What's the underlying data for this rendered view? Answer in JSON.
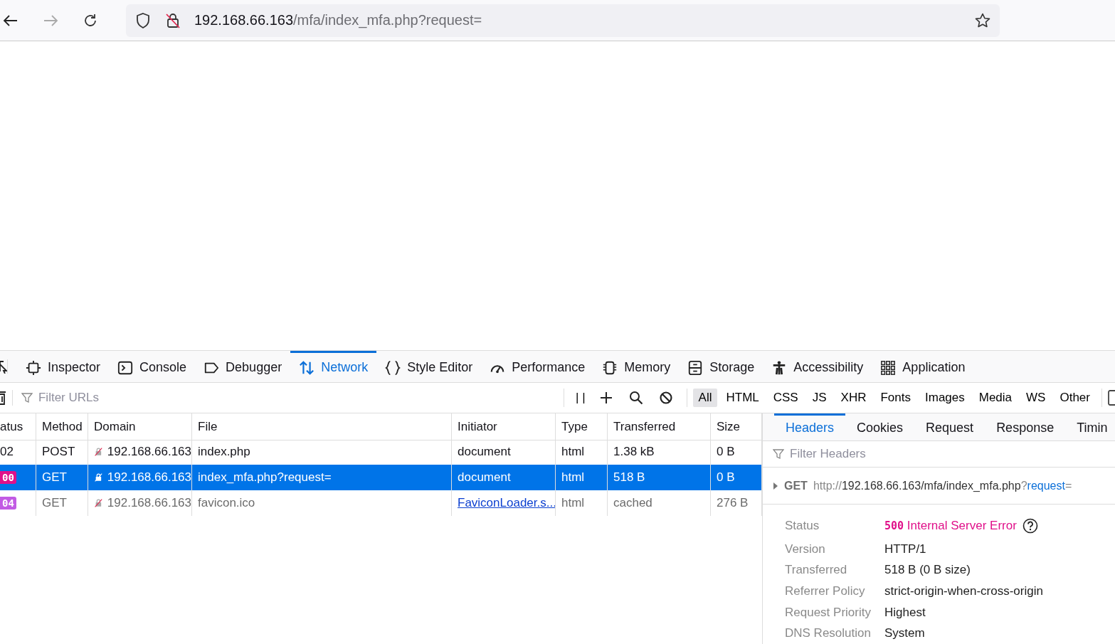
{
  "browser": {
    "url_host": "192.168.66.163",
    "url_path": "/mfa/index_mfa.php?request="
  },
  "devtools_tabs": [
    {
      "label": "Inspector",
      "selected": false
    },
    {
      "label": "Console",
      "selected": false
    },
    {
      "label": "Debugger",
      "selected": false
    },
    {
      "label": "Network",
      "selected": true
    },
    {
      "label": "Style Editor",
      "selected": false
    },
    {
      "label": "Performance",
      "selected": false
    },
    {
      "label": "Memory",
      "selected": false
    },
    {
      "label": "Storage",
      "selected": false
    },
    {
      "label": "Accessibility",
      "selected": false
    },
    {
      "label": "Application",
      "selected": false
    }
  ],
  "toolbar": {
    "pause_label": "| |",
    "filter_placeholder": "Filter URLs",
    "type_filters": [
      {
        "label": "All",
        "selected": true
      },
      {
        "label": "HTML",
        "selected": false
      },
      {
        "label": "CSS",
        "selected": false
      },
      {
        "label": "JS",
        "selected": false
      },
      {
        "label": "XHR",
        "selected": false
      },
      {
        "label": "Fonts",
        "selected": false
      },
      {
        "label": "Images",
        "selected": false
      },
      {
        "label": "Media",
        "selected": false
      },
      {
        "label": "WS",
        "selected": false
      },
      {
        "label": "Other",
        "selected": false
      }
    ]
  },
  "table": {
    "columns": [
      "atus",
      "Method",
      "Domain",
      "File",
      "Initiator",
      "Type",
      "Transferred",
      "Size"
    ],
    "rows": [
      {
        "status": "02",
        "method": "POST",
        "domain": "192.168.66.163",
        "file": "index.php",
        "initiator": "document",
        "initiator_link": false,
        "type": "html",
        "transferred": "1.38 kB",
        "size": "0 B",
        "selected": false,
        "muted": false
      },
      {
        "status": "00",
        "color": "#e0118a",
        "method": "GET",
        "domain": "192.168.66.163",
        "file": "index_mfa.php?request=",
        "initiator": "document",
        "initiator_link": false,
        "type": "html",
        "transferred": "518 B",
        "size": "0 B",
        "selected": true,
        "muted": false
      },
      {
        "status": "04",
        "color": "#c25be4",
        "method": "GET",
        "domain": "192.168.66.163",
        "file": "favicon.ico",
        "initiator": "FaviconLoader.s...",
        "initiator_link": true,
        "type": "html",
        "transferred": "cached",
        "size": "276 B",
        "selected": false,
        "muted": true
      }
    ]
  },
  "details": {
    "tabs": [
      {
        "label": "Headers",
        "selected": true
      },
      {
        "label": "Cookies",
        "selected": false
      },
      {
        "label": "Request",
        "selected": false
      },
      {
        "label": "Response",
        "selected": false
      },
      {
        "label": "Timin",
        "selected": false
      }
    ],
    "filter_placeholder": "Filter Headers",
    "method": "GET",
    "url_parts": [
      {
        "text": "http://",
        "kind": "dim"
      },
      {
        "text": "192.168.66.163/mfa/index_mfa.php",
        "kind": "main"
      },
      {
        "text": "?",
        "kind": "dim"
      },
      {
        "text": "request",
        "kind": "param"
      },
      {
        "text": "=",
        "kind": "dim"
      }
    ],
    "fields": [
      {
        "label": "Status",
        "kind": "status",
        "code": "500",
        "value": "Internal Server Error",
        "color": "#e0118a"
      },
      {
        "label": "Version",
        "kind": "plain",
        "value": "HTTP/1"
      },
      {
        "label": "Transferred",
        "kind": "plain",
        "value": "518 B (0 B size)"
      },
      {
        "label": "Referrer Policy",
        "kind": "plain",
        "value": "strict-origin-when-cross-origin"
      },
      {
        "label": "Request Priority",
        "kind": "plain",
        "value": "Highest"
      },
      {
        "label": "DNS Resolution",
        "kind": "plain",
        "value": "System"
      }
    ]
  }
}
